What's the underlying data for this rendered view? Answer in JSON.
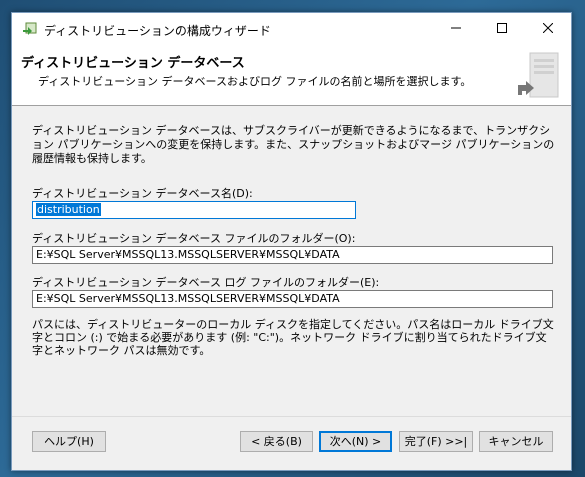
{
  "window": {
    "title": "ディストリビューションの構成ウィザード"
  },
  "header": {
    "title": "ディストリビューション データベース",
    "subtitle": "ディストリビューション データベースおよびログ ファイルの名前と場所を選択します。"
  },
  "content": {
    "description": "ディストリビューション データベースは、サブスクライバーが更新できるようになるまで、トランザクション パブリケーションへの変更を保持します。また、スナップショットおよびマージ パブリケーションの履歴情報も保持します。",
    "db_name_label": "ディストリビューション データベース名(D):",
    "db_name_value": "distribution",
    "db_folder_label": "ディストリビューション データベース ファイルのフォルダー(O):",
    "db_folder_value": "E:¥SQL Server¥MSSQL13.MSSQLSERVER¥MSSQL¥DATA",
    "log_folder_label": "ディストリビューション データベース ログ ファイルのフォルダー(E):",
    "log_folder_value": "E:¥SQL Server¥MSSQL13.MSSQLSERVER¥MSSQL¥DATA",
    "note": "パスには、ディストリビューターのローカル ディスクを指定してください。パス名はローカル ドライブ文字とコロン (:) で始まる必要があります (例: \"C:\")。ネットワーク ドライブに割り当てられたドライブ文字とネットワーク パスは無効です。"
  },
  "buttons": {
    "help": "ヘルプ(H)",
    "back": "< 戻る(B)",
    "next": "次へ(N) >",
    "finish": "完了(F) >>|",
    "cancel": "キャンセル"
  },
  "colors": {
    "accent": "#0078d7",
    "window_bg": "#f0f0f0"
  },
  "icons": {
    "app": "wizard-app-icon",
    "minimize": "minimize-icon",
    "maximize": "maximize-icon",
    "close": "close-icon",
    "header_art": "database-arrow-illustration"
  }
}
